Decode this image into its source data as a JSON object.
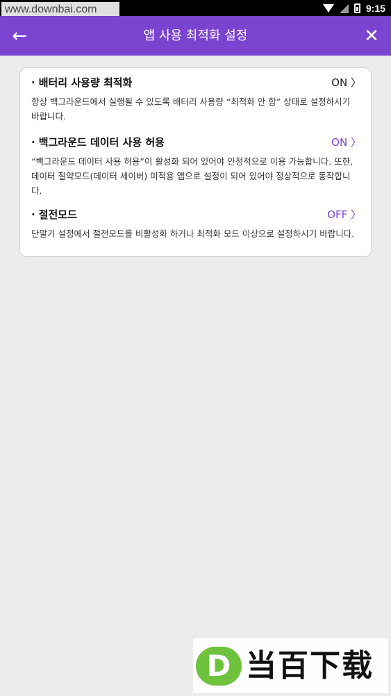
{
  "status_bar": {
    "watermark": "www.downbai.com",
    "time": "9:15"
  },
  "app_bar": {
    "title": "앱 사용 최적화 설정",
    "back_icon": "←",
    "close_icon": "✕",
    "color": "#7a44d0"
  },
  "sections": [
    {
      "title": "배터리 사용량 최적화",
      "status": "ON",
      "status_color": "#222222",
      "description": "항상 백그라운드에서 실행될 수 있도록 배터리 사용량 “최적화 안 함” 상태로 설정하시기 바랍니다."
    },
    {
      "title": "백그라운드 데이터 사용 허용",
      "status": "ON",
      "status_color": "#7a44d0",
      "description": "“백그라운드 데이터 사용 허용”이 활성화 되어 있어야 안정적으로 이용 가능합니다. 또한, 데이터 절약모드(데이터 세이버) 미적용 앱으로 설정이 되어 있어야 정상적으로 동작합니다."
    },
    {
      "title": "절전모드",
      "status": "OFF",
      "status_color": "#7a44d0",
      "description": "단말기 설정에서 절전모드를 비활성화 하거나 최적화 모드 이상으로 설정하시기 바랍니다."
    }
  ],
  "chevron": "〉",
  "bullet": "·",
  "bottom_logo": {
    "letter": "D",
    "text": "当百下载"
  }
}
